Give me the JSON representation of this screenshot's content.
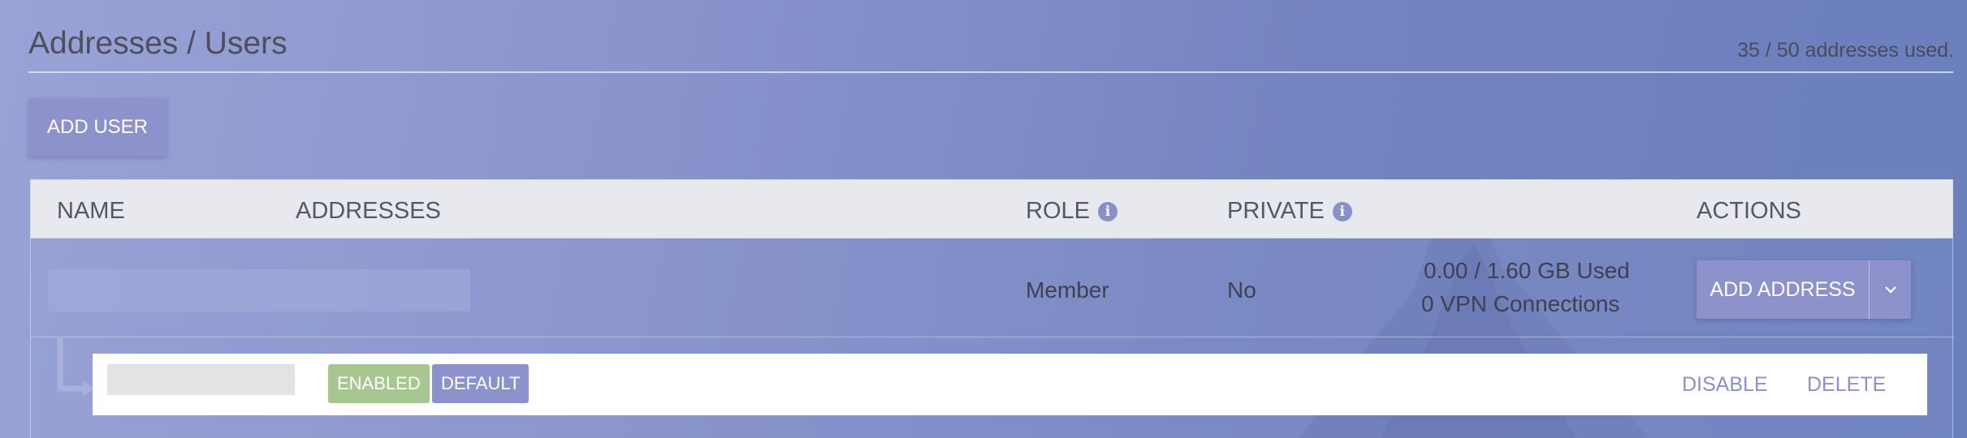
{
  "page": {
    "title": "Addresses / Users",
    "usage": "35 / 50 addresses used."
  },
  "toolbar": {
    "add_user_label": "ADD USER"
  },
  "table": {
    "columns": {
      "name": "NAME",
      "addresses": "ADDRESSES",
      "role": "ROLE",
      "private": "PRIVATE",
      "actions": "ACTIONS"
    },
    "rows": [
      {
        "role": "Member",
        "private": "No",
        "storage_used": "0.00 / 1.60 GB Used",
        "vpn_connections": "0 VPN Connections",
        "add_address_label": "ADD ADDRESS",
        "addresses": [
          {
            "badges": [
              "ENABLED",
              "DEFAULT"
            ],
            "disable_label": "DISABLE",
            "delete_label": "DELETE"
          }
        ]
      }
    ]
  },
  "colors": {
    "accent": "#8d91cc",
    "enabled_badge": "#a6c78f",
    "header_bg": "#e7e9ef"
  },
  "icons": [
    "info-icon",
    "chevron-down-icon",
    "tree-connector-icon"
  ]
}
